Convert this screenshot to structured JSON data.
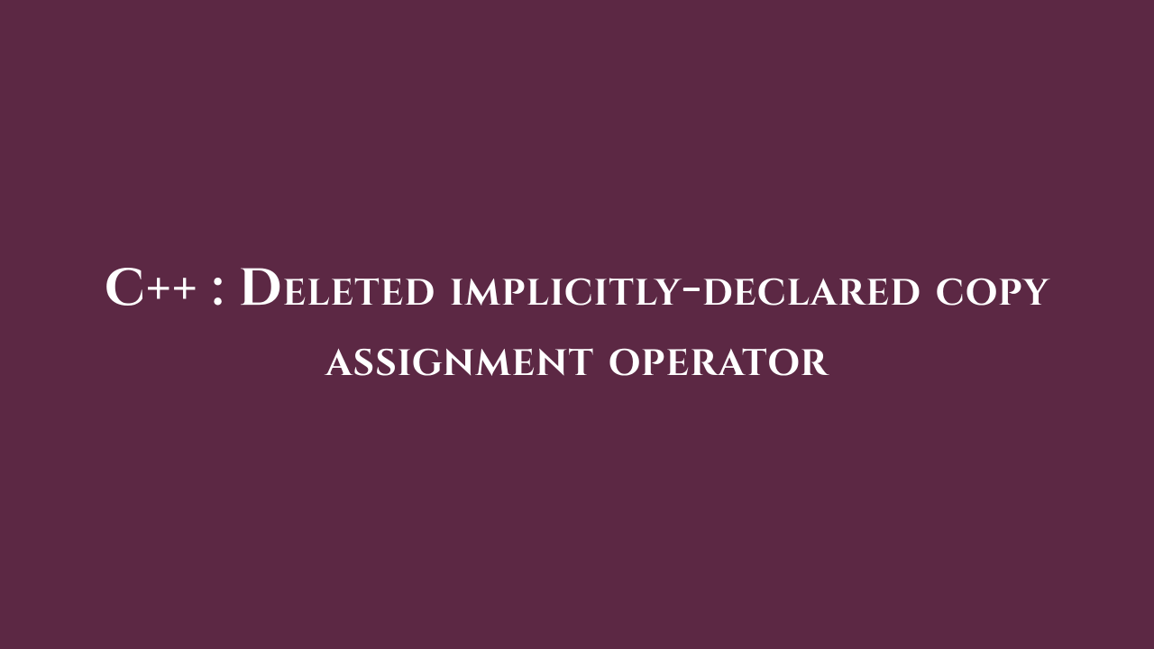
{
  "title": {
    "text": "C++ : Deleted implicitly-declared copy assignment operator"
  },
  "background_color": "#5c2844",
  "text_color": "#ffffff"
}
